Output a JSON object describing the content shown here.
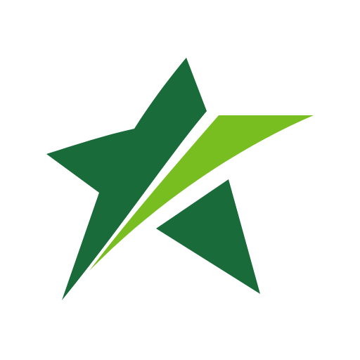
{
  "logo": {
    "icon": "star-logo-icon",
    "colors": {
      "background": "#ffffff",
      "star_dark_green": "#1a6b3a",
      "swoosh_light_green": "#78be20"
    }
  }
}
